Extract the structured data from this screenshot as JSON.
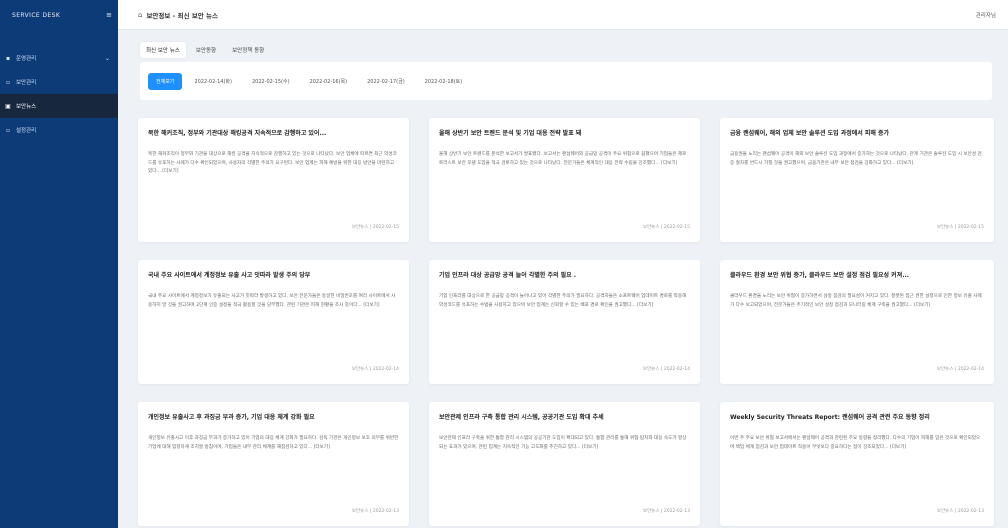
{
  "sidebar": {
    "brand": "SERVICE DESK",
    "items": [
      {
        "label": "운영관리",
        "expandable": true
      },
      {
        "label": "보안관리",
        "expandable": false
      },
      {
        "label": "보안뉴스",
        "expandable": false,
        "active": true
      },
      {
        "label": "설정관리",
        "expandable": false
      }
    ]
  },
  "header": {
    "title": "보안정보 - 최신 보안 뉴스",
    "user": "관리자님"
  },
  "tabs": [
    "최신 보안 뉴스",
    "보안동향",
    "보안정책 동향"
  ],
  "date_filters": [
    "전체보기",
    "2022-02-14(화)",
    "2022-02-15(수)",
    "2022-02-16(목)",
    "2022-02-17(금)",
    "2022-02-18(토)"
  ],
  "cards": [
    {
      "title": "북한 해커조직, 정부와 기관대상 해킹공격 지속적으로 감행하고 있어...",
      "body": "북한 해커조직이 정부와 기관을 대상으로 해킹 공격을 지속적으로 감행하고 있는 것으로 나타났다. 보안 업체에 따르면 최근 악성코드를 유포하는 사례가 다수 확인되었으며, 사용자의 각별한 주의가 요구된다. 보안 업계는 피해 예방을 위한 대응 방안을 마련하고 있다... [더보기]",
      "meta": "보안뉴스 | 2022-02-15"
    },
    {
      "title": "올해 상반기 보안 트렌드 분석 및 기업 대응 전략 발표 돼",
      "body": "올해 상반기 보안 트렌드를 분석한 보고서가 발표됐다. 보고서는 랜섬웨어와 공급망 공격이 주요 위협으로 꼽혔으며 기업들은 제로트러스트 보안 모델 도입을 적극 검토하고 있는 것으로 나타났다. 전문가들은 체계적인 대응 전략 수립을 강조했다... [더보기]",
      "meta": "보안뉴스 | 2022-02-15"
    },
    {
      "title": "금융 랜섬웨어, 해외 업체 보안 솔루션 도입 과정에서 피해 증가",
      "body": "금융권을 노리는 랜섬웨어 공격이 해외 보안 솔루션 도입 과정에서 증가하는 것으로 나타났다. 관계 기관은 솔루션 도입 시 보안성 검증 절차를 반드시 거칠 것을 권고했으며, 금융기관은 내부 보안 점검을 강화하고 있다... [더보기]",
      "meta": "보안뉴스 | 2022-02-15"
    },
    {
      "title": "국내 주요 사이트에서 계정정보 유출 사고 잇따라 발생 주의 당부",
      "body": "국내 주요 사이트에서 계정정보가 유출되는 사고가 잇따라 발생하고 있다. 보안 전문가들은 동일한 비밀번호를 여러 사이트에서 사용하지 말 것을 권고하며 2단계 인증 설정을 적극 활용할 것을 당부했다. 관련 기관은 피해 현황을 조사 중이다... [더보기]",
      "meta": "보안뉴스 | 2022-02-14"
    },
    {
      "title": "기업 인프라 대상 공급망 공격 늘어 각별한 주의 필요 .",
      "body": "기업 인프라를 대상으로 한 공급망 공격이 늘어나고 있어 각별한 주의가 필요하다. 공격자들은 소프트웨어 업데이트 경로를 악용해 악성코드를 유포하는 수법을 사용하고 있으며 보안 업계는 신뢰할 수 있는 배포 경로 확인을 권고했다... [더보기]",
      "meta": "보안뉴스 | 2022-02-14"
    },
    {
      "title": "클라우드 환경 보안 위협 증가, 클라우드 보안 설정 점검 필요성 커져...",
      "body": "클라우드 환경을 노리는 보안 위협이 증가하면서 설정 점검의 필요성이 커지고 있다. 잘못된 접근 권한 설정으로 인한 정보 유출 사례가 다수 보고되었으며, 전문가들은 주기적인 보안 설정 점검과 모니터링 체계 구축을 권고했다... [더보기]",
      "meta": "보안뉴스 | 2022-02-14"
    },
    {
      "title": "개인정보 유출사고 후 과징금 부과 증가, 기업 대응 체계 강화 필요",
      "body": "개인정보 유출사고 이후 과징금 부과가 증가하고 있어 기업의 대응 체계 강화가 필요하다. 감독 기관은 개인정보 보호 의무를 위반한 기업에 대해 엄정하게 조치할 방침이며, 기업들은 내부 관리 체계를 재점검하고 있다... [더보기]",
      "meta": "보안뉴스 | 2022-02-13"
    },
    {
      "title": "보안관제 인프라 구축 통합 관리 시스템, 공공기관 도입 확대 추세",
      "body": "보안관제 인프라 구축을 위한 통합 관리 시스템의 공공기관 도입이 확대되고 있다. 통합 관리를 통해 위협 탐지와 대응 속도가 향상되는 효과가 있으며, 관련 업계는 지속적인 기능 고도화를 추진하고 있다... [더보기]",
      "meta": "보안뉴스 | 2022-02-13"
    },
    {
      "title": "Weekly Security Threats Report: 랜섬웨어 공격 관련 주요 동향 정리",
      "body": "이번 주 주요 보안 위협 보고서에서는 랜섬웨어 공격과 관련된 주요 동향을 정리했다. 다수의 기업이 피해를 입은 것으로 확인되었으며 백업 체계 점검과 보안 업데이트 적용이 무엇보다 중요하다는 점이 강조되었다... [더보기]",
      "meta": "보안뉴스 | 2022-02-13"
    }
  ]
}
